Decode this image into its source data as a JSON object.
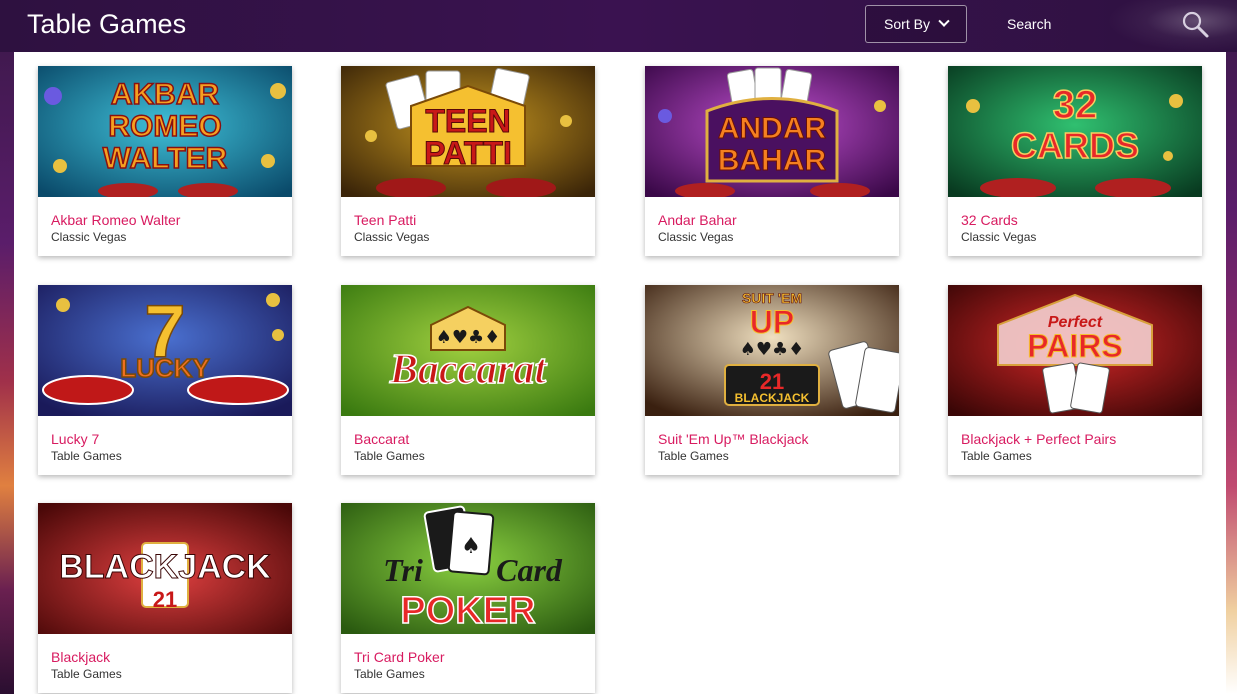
{
  "header": {
    "title": "Table Games",
    "sort_label": "Sort By",
    "search_label": "Search"
  },
  "games": [
    {
      "title": "Akbar Romeo Walter",
      "category": "Classic Vegas",
      "logo_lines": [
        "AKBAR",
        "ROMEO",
        "WALTER"
      ]
    },
    {
      "title": "Teen Patti",
      "category": "Classic Vegas",
      "logo_lines": [
        "TEEN",
        "PATTI"
      ]
    },
    {
      "title": "Andar Bahar",
      "category": "Classic Vegas",
      "logo_lines": [
        "ANDAR",
        "BAHAR"
      ]
    },
    {
      "title": "32 Cards",
      "category": "Classic Vegas",
      "logo_lines": [
        "32",
        "CARDS"
      ]
    },
    {
      "title": "Lucky 7",
      "category": "Table Games",
      "logo_lines": [
        "7",
        "LUCKY"
      ]
    },
    {
      "title": "Baccarat",
      "category": "Table Games",
      "logo_lines": [
        "Baccarat"
      ]
    },
    {
      "title": "Suit 'Em Up™ Blackjack",
      "category": "Table Games",
      "logo_lines": [
        "SUIT 'EM",
        "UP",
        "21",
        "BLACKJACK"
      ]
    },
    {
      "title": "Blackjack + Perfect Pairs",
      "category": "Table Games",
      "logo_lines": [
        "Perfect",
        "PAIRS"
      ]
    },
    {
      "title": "Blackjack",
      "category": "Table Games",
      "logo_lines": [
        "BLACKJACK",
        "21"
      ]
    },
    {
      "title": "Tri Card Poker",
      "category": "Table Games",
      "logo_lines": [
        "Tri",
        "Card",
        "POKER"
      ]
    }
  ]
}
